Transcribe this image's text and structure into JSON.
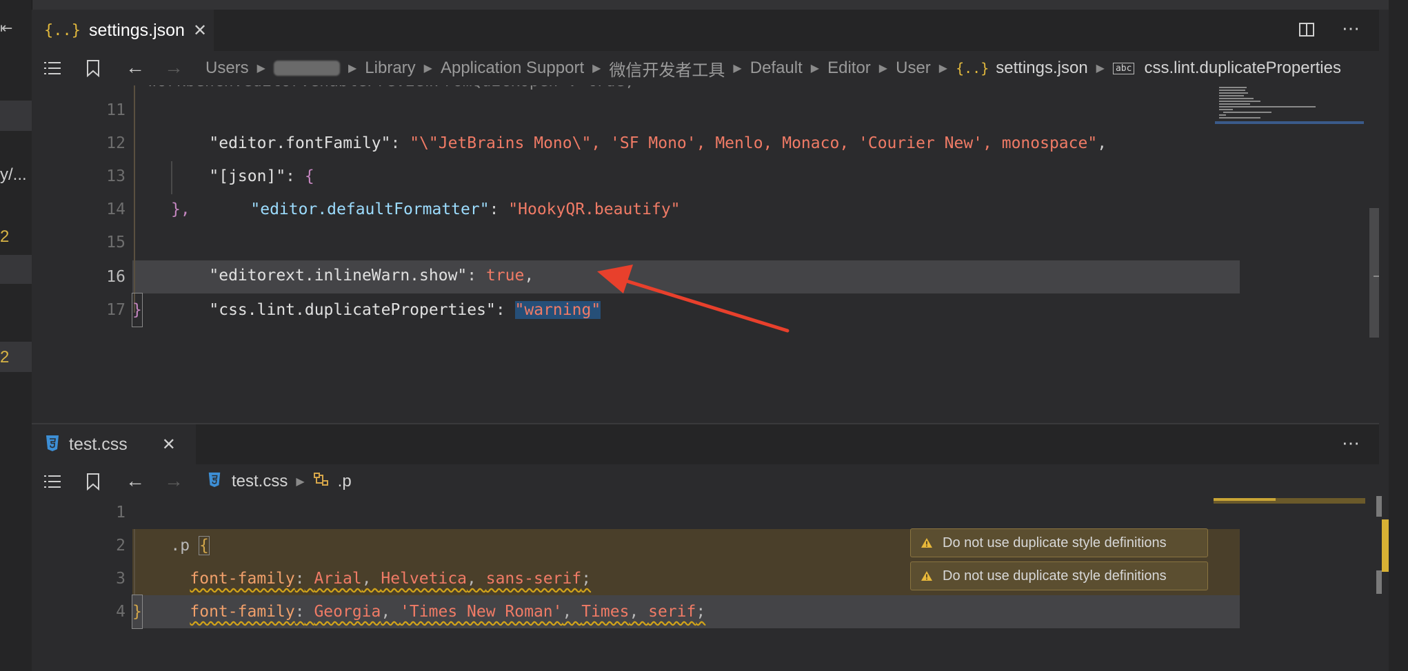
{
  "top_editor": {
    "tab": {
      "icon": "{..}",
      "label": "settings.json"
    },
    "breadcrumb": [
      "Users",
      "Library",
      "Application Support",
      "微信开发者工具",
      "Default",
      "Editor",
      "User"
    ],
    "breadcrumb_file": "settings.json",
    "breadcrumb_symbol_icon": "abc",
    "breadcrumb_symbol": "css.lint.duplicateProperties",
    "partial_line": "\"workbench.editor.enablePreviewFromQuickOpen\": true,",
    "lines": [
      {
        "n": "11",
        "key": "\"editor.fontFamily\"",
        "colon": ": ",
        "value": "\"\\\"JetBrains Mono\\\", 'SF Mono', Menlo, Monaco, 'Courier New', monospace\"",
        "end": ","
      },
      {
        "n": "12",
        "key": "\"[json]\"",
        "colon": ": ",
        "value": "{"
      },
      {
        "n": "13",
        "key": "\"editor.defaultFormatter\"",
        "colon": ": ",
        "value": "\"HookyQR.beautify\""
      },
      {
        "n": "14",
        "value": "},"
      },
      {
        "n": "15",
        "key": "\"editorext.inlineWarn.show\"",
        "colon": ": ",
        "value": "true",
        "end": ","
      },
      {
        "n": "16",
        "key": "\"css.lint.duplicateProperties\"",
        "colon": ": ",
        "quote": "\"",
        "value": "warning"
      },
      {
        "n": "17",
        "value": "}"
      }
    ]
  },
  "bottom_editor": {
    "tab": {
      "icon": "css3",
      "label": "test.css"
    },
    "breadcrumb_file": "test.css",
    "breadcrumb_symbol": ".p",
    "lines": [
      {
        "n": "1",
        "selector": ".p",
        "brace": "{"
      },
      {
        "n": "2",
        "prop": "font-family",
        "colon": ":",
        "vals": [
          "Arial",
          ", ",
          "Helvetica",
          ", ",
          "sans-serif"
        ],
        "semi": ";"
      },
      {
        "n": "3",
        "prop": "font-family",
        "colon": ":",
        "vals": [
          "Georgia",
          ", ",
          "'Times New Roman'",
          ", ",
          "Times",
          ", ",
          "serif"
        ],
        "semi": ";"
      },
      {
        "n": "4",
        "brace": "}"
      }
    ],
    "warnings": [
      "Do not use duplicate style definitions",
      "Do not use duplicate style definitions"
    ]
  },
  "sidebar_fragments": {
    "text1": "y/...",
    "badge1": "2",
    "badge2": "2"
  },
  "colors": {
    "accent_warning": "#e8b83a",
    "arrow": "#e8402c"
  }
}
